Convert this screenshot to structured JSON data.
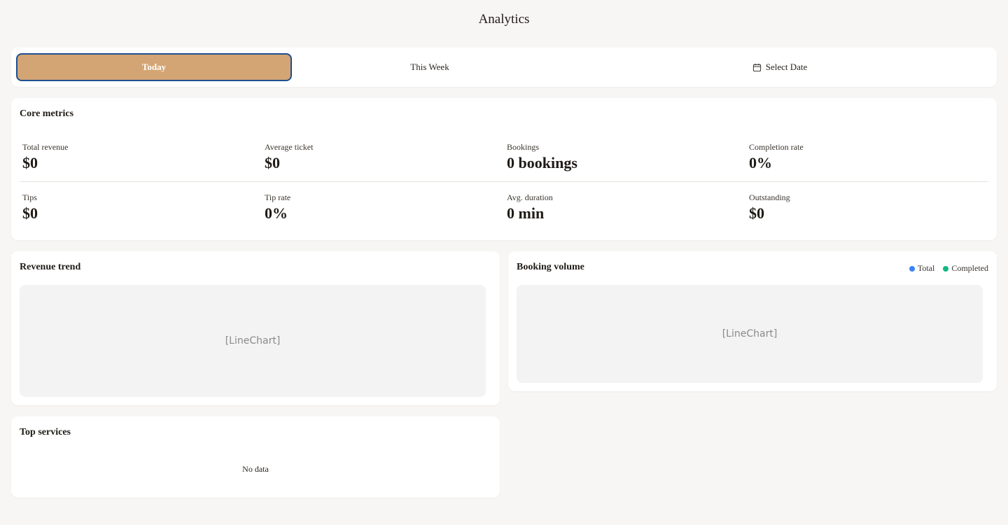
{
  "page": {
    "title": "Analytics"
  },
  "range_tabs": {
    "today": "Today",
    "this_week": "This Week",
    "select_date": "Select Date",
    "active_color": "#d4a574",
    "active_border_color": "#1f4f8f",
    "select_date_icon": "calendar-icon"
  },
  "core_metrics": {
    "title": "Core metrics",
    "metrics": [
      {
        "label": "Total revenue",
        "value": "$0"
      },
      {
        "label": "Average ticket",
        "value": "$0"
      },
      {
        "label": "Bookings",
        "value": "0 bookings"
      },
      {
        "label": "Completion rate",
        "value": "0%"
      },
      {
        "label": "Tips",
        "value": "$0"
      },
      {
        "label": "Tip rate",
        "value": "0%"
      },
      {
        "label": "Avg. duration",
        "value": "0 min"
      },
      {
        "label": "Outstanding",
        "value": "$0"
      }
    ]
  },
  "revenue_trend": {
    "title": "Revenue trend",
    "placeholder": "[LineChart]"
  },
  "booking_volume": {
    "title": "Booking volume",
    "placeholder": "[LineChart]",
    "legend": [
      {
        "label": "Total",
        "color": "#3b82f6"
      },
      {
        "label": "Completed",
        "color": "#10b981"
      }
    ]
  },
  "top_services": {
    "title": "Top services",
    "empty_text": "No data"
  }
}
